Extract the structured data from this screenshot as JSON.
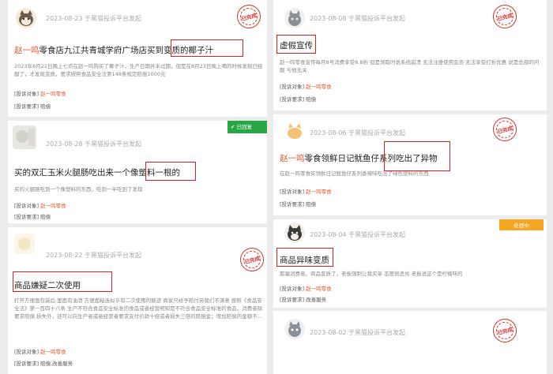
{
  "platform_text": "于黑猫投诉平台发起",
  "labels": {
    "target": "[投诉对象]",
    "demand": "[投诉要求]"
  },
  "statuses": {
    "completed": "已完成",
    "replied": "✔ 已回复",
    "processing": "处理中"
  },
  "colors": {
    "brand": "#e8532b",
    "stamp_red": "#d9332b",
    "replied_green": "#28a745",
    "processing_orange": "#f5a623",
    "highlight_box": "#e02020"
  },
  "cards": [
    {
      "date": "2023-08-23",
      "title_brand": "赵一鸣",
      "title_rest": "零食店九江共青城学府广场店买到变质的椰子汁",
      "description": "2023年8月22日晚上七点在赵一鸣购买了椰子汁，生产日期并未过期，但是在8月23日晚上喝的时候发现已经酸了，才发现变质，要求按照食品安全法第148条规定赔偿1000元",
      "target": "赵一鸣零食",
      "demand": "赔偿",
      "status": "completed",
      "avatar": "cat-avatar"
    },
    {
      "date": "2023-08-28",
      "title_brand": "",
      "title_rest": "买的双汇玉米火腿肠吃出来一个像塑料一根的",
      "description": "买的火腿肠吃到一个像塑料的东西，吃到一半吃到了发现",
      "target": "赵一鸣零食",
      "demand": "赔偿",
      "status": "replied",
      "avatar": "blurred-avatar"
    },
    {
      "date": "2023-08-22",
      "title_brand": "",
      "title_rest": "商品嫌疑二次使用",
      "description": "打开方便面包装后 里面有油渍 方便面粘连似乎有二次使用的痕迹 商家只给予赔付另我们不满意 按照《食品安全法》第一百四十八条 生产不符合食品安全标准的食品或者经营明知是不符合食品安全标准的食品，消费者除要求赔偿 损失外，还可以向生产者或者经营者要求支付价款十倍或者损失三倍的赔偿金；增加赔偿的金额不...",
      "target": "赵一鸣零食",
      "demand": "赔偿,改善服务",
      "status": "completed",
      "avatar": "default-avatar"
    },
    {
      "date": "2023-08-08",
      "title_brand": "",
      "title_rest": "虚假宣传",
      "description": "赵一鸣零食宣传每月8号消费享受8.8折 但是领取时说系统崩溃 无法注册使用会员 无法享受打折优惠 说是总部的问题 与他无关",
      "target": "赵一鸣零食",
      "demand": "赔偿",
      "status": "completed",
      "avatar": "grey-cat-avatar"
    },
    {
      "date": "2023-08-06",
      "title_brand": "赵一鸣",
      "title_rest": "零食领鲜日记鱿鱼仔系列吃出了异物",
      "description": "在赵一鸣零食买领鲜日记鱿鱼仔系列香辣味吃出了绿色塑料的东西",
      "target": "赵一鸣零食",
      "demand": "赔偿",
      "status": "completed",
      "avatar": "orange-cat-avatar"
    },
    {
      "date": "2023-08-04",
      "title_brand": "",
      "title_rest": "商品异味变质",
      "description": "欺骗消费者。商品变质了，老板强制让我买单 态度很恶劣 老板说这个是柠檬味的",
      "target": "赵一鸣零食",
      "demand": "改善服务",
      "status": "processing",
      "avatar": "dark-cat-avatar"
    },
    {
      "date": "2023-08-02",
      "title_brand": "",
      "title_rest": "",
      "description": "",
      "target": "",
      "demand": "",
      "status": "completed",
      "avatar": "grey-cat-avatar"
    }
  ]
}
